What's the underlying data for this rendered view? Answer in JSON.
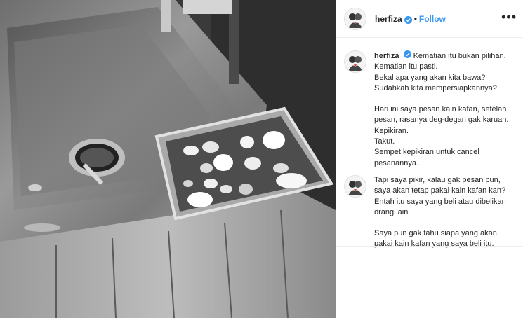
{
  "post": {
    "username": "herfiza",
    "follow_label": "Follow",
    "separator": "•",
    "more_label": "•••"
  },
  "caption": {
    "username": "herfiza",
    "first_line": "Kematian itu bukan pilihan.",
    "lines_a": [
      "Kematian itu pasti.",
      "Bekal apa yang akan kita bawa?",
      "Sudahkah kita mempersiapkannya?"
    ],
    "lines_b": [
      "Hari ini saya pesan kain kafan, setelah",
      "pesan, rasanya deg-degan gak karuan.",
      "Kepikiran.",
      "Takut.",
      "Sempet kepikiran untuk cancel",
      "pesanannya."
    ]
  },
  "comment2": {
    "lines_a": [
      "Tapi saya pikir, kalau gak pesan pun,",
      "saya akan tetap pakai kain kafan kan?",
      "Entah itu saya yang beli atau dibelikan",
      "orang lain."
    ],
    "lines_b": [
      "Saya pun gak tahu siapa yang akan",
      "pakai kain kafan yang saya beli itu."
    ]
  },
  "colors": {
    "follow": "#3897f0",
    "verified": "#3897f0",
    "text": "#262626",
    "border": "#efefef"
  },
  "icons": {
    "verified": "verified-badge-icon",
    "more": "more-options-icon"
  }
}
